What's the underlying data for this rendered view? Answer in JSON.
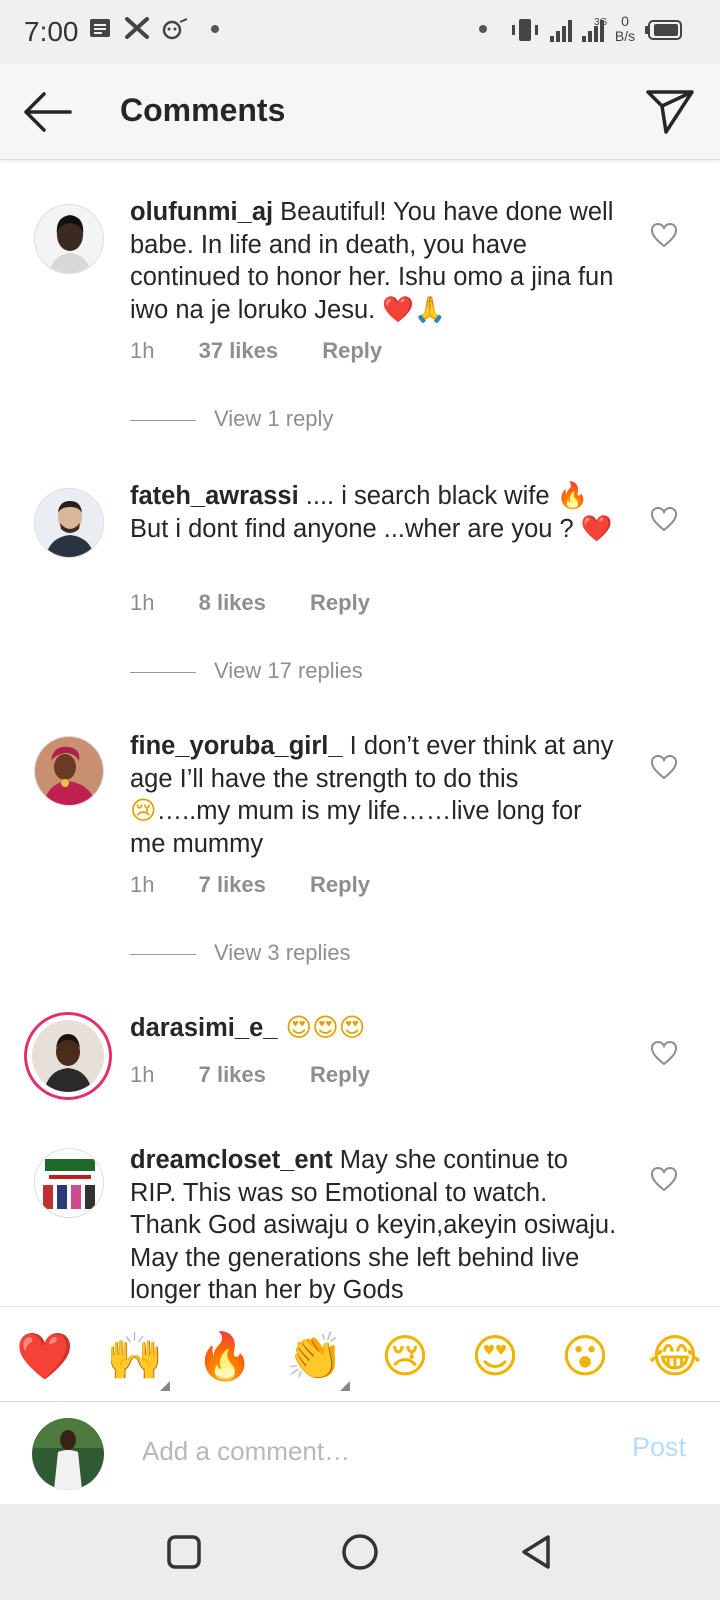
{
  "status_bar": {
    "time": "7:00",
    "network_label": "3G",
    "speed_value": "0",
    "speed_unit": "B/s"
  },
  "header": {
    "title": "Comments"
  },
  "comments": [
    {
      "username": "olufunmi_aj",
      "text": " Beautiful! You have done well babe. In life and in death, you have continued to honor her. Ishu omo a jina fun iwo na je loruko Jesu. ",
      "emoji": "❤️🙏",
      "time": "1h",
      "likes": "37 likes",
      "reply": "Reply",
      "view_replies": "View 1 reply"
    },
    {
      "username": "fateh_awrassi",
      "text": " .... i search black wife ",
      "emoji_inline": "🔥",
      "text2": " But i dont find anyone ...wher are you ? ",
      "emoji": "❤️",
      "time": "1h",
      "likes": "8 likes",
      "reply": "Reply",
      "view_replies": "View 17 replies"
    },
    {
      "username": "fine_yoruba_girl_",
      "text": " I don’t ever think at any age I’ll have the strength to do this ",
      "emoji_inline": "😢",
      "text2": "…..my mum is my life……live long for me mummy",
      "time": "1h",
      "likes": "7 likes",
      "reply": "Reply",
      "view_replies": "View 3 replies"
    },
    {
      "username": "darasimi_e_",
      "emoji": " 😍😍😍",
      "time": "1h",
      "likes": "7 likes",
      "reply": "Reply"
    },
    {
      "username": "dreamcloset_ent",
      "text": " May she continue to RIP. This was so Emotional to watch. Thank God asiwaju o keyin,akeyin osiwaju. May the generations she left behind live longer than her by Gods"
    }
  ],
  "emoji_bar": [
    "❤️",
    "🙌",
    "🔥",
    "👏",
    "😢",
    "😍",
    "😮",
    "😂"
  ],
  "comment_input": {
    "placeholder": "Add a comment…",
    "post_label": "Post"
  },
  "colors": {
    "accent_link_disabled": "#b3dbff",
    "heart_red": "#e0203a",
    "secondary_text": "#8e8e8e"
  }
}
